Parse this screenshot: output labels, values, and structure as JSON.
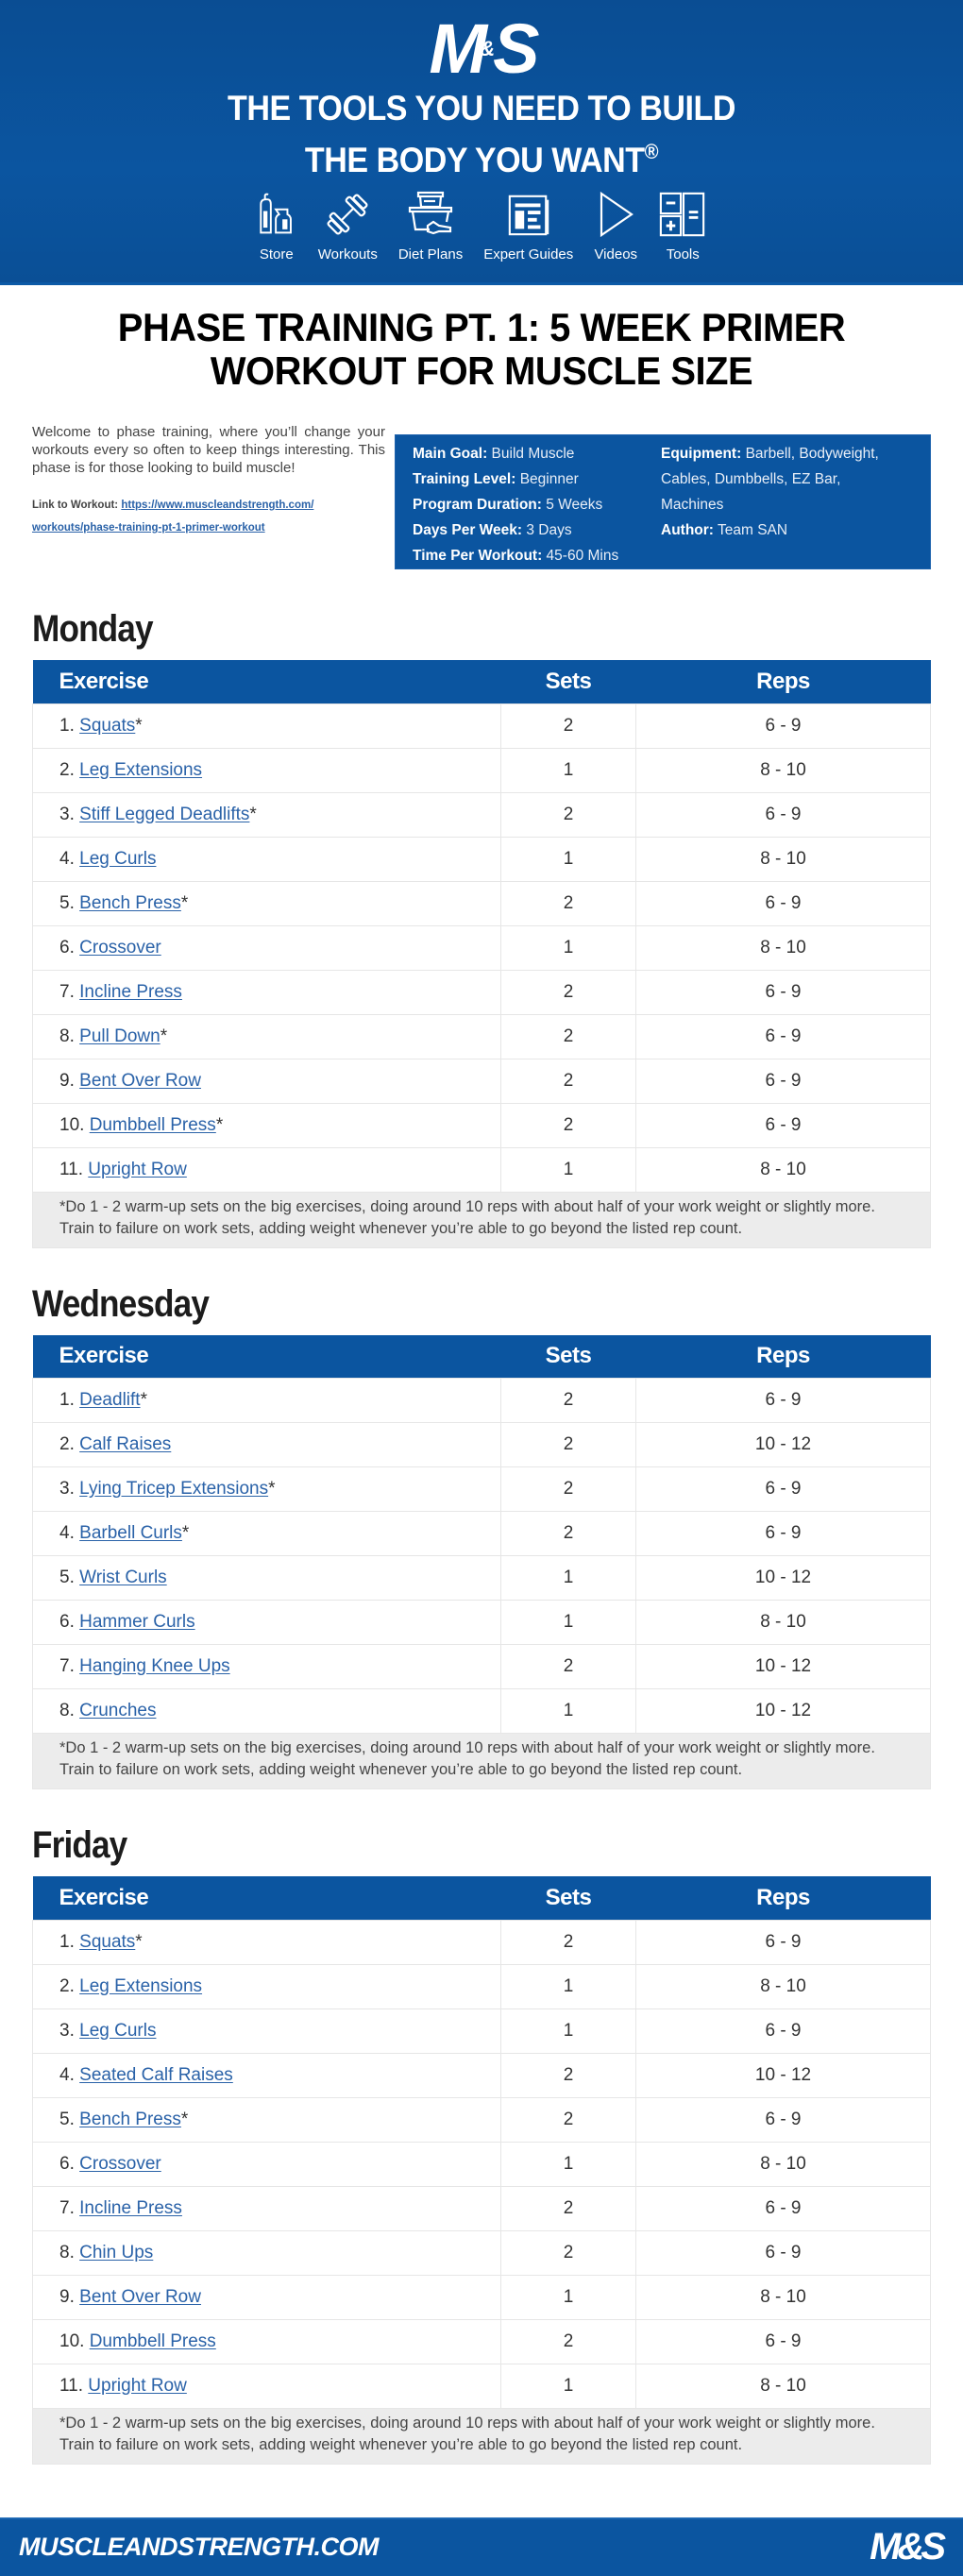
{
  "header": {
    "logo_text": "M&S",
    "tagline_line1": "THE TOOLS YOU NEED TO BUILD",
    "tagline_line2": "THE BODY YOU WANT",
    "tagline_mark": "®",
    "nav": [
      {
        "label": "Store",
        "icon": "store-icon"
      },
      {
        "label": "Workouts",
        "icon": "dumbbell-icon"
      },
      {
        "label": "Diet Plans",
        "icon": "diet-plans-icon"
      },
      {
        "label": "Expert Guides",
        "icon": "expert-guides-icon"
      },
      {
        "label": "Videos",
        "icon": "play-icon"
      },
      {
        "label": "Tools",
        "icon": "calculator-icon"
      }
    ]
  },
  "title_line1": "PHASE TRAINING PT. 1: 5 WEEK PRIMER",
  "title_line2": "WORKOUT FOR MUSCLE SIZE",
  "intro": {
    "text": "Welcome to phase training, where you’ll change your workouts every so often to keep things interesting. This phase is for those looking to build muscle!",
    "link_label": "Link to Workout:",
    "link_url_line1": "https://www.muscleandstrength.com/",
    "link_url_line2": "workouts/phase-training-pt-1-primer-workout"
  },
  "info": {
    "main_goal": {
      "label": "Main Goal:",
      "value": "Build Muscle"
    },
    "training_level": {
      "label": "Training Level:",
      "value": "Beginner"
    },
    "program_duration": {
      "label": "Program Duration:",
      "value": "5 Weeks"
    },
    "days_per_week": {
      "label": "Days Per Week:",
      "value": "3 Days"
    },
    "time_per_workout": {
      "label": "Time Per Workout:",
      "value": "45-60 Mins"
    },
    "equipment": {
      "label": "Equipment:",
      "value_line1": "Barbell, Bodyweight,",
      "value_line2": "Cables, Dumbbells, EZ Bar,",
      "value_line3": "Machines"
    },
    "author": {
      "label": "Author:",
      "value": "Team SAN"
    }
  },
  "table_headers": {
    "exercise": "Exercise",
    "sets": "Sets",
    "reps": "Reps"
  },
  "days": [
    {
      "name": "Monday",
      "rows": [
        {
          "num": "1.",
          "name": "Squats",
          "star": "*",
          "sets": "2",
          "reps": "6 - 9"
        },
        {
          "num": "2.",
          "name": "Leg Extensions",
          "star": "",
          "sets": "1",
          "reps": "8 - 10"
        },
        {
          "num": "3.",
          "name": "Stiff Legged Deadlifts",
          "star": "*",
          "sets": "2",
          "reps": "6 - 9"
        },
        {
          "num": "4.",
          "name": "Leg Curls",
          "star": "",
          "sets": "1",
          "reps": "8 - 10"
        },
        {
          "num": "5.",
          "name": "Bench Press",
          "star": "*",
          "sets": "2",
          "reps": "6 - 9"
        },
        {
          "num": "6.",
          "name": "Crossover",
          "star": "",
          "sets": "1",
          "reps": "8 - 10"
        },
        {
          "num": "7.",
          "name": "Incline Press",
          "star": "",
          "sets": "2",
          "reps": "6 - 9"
        },
        {
          "num": "8.",
          "name": "Pull Down",
          "star": "*",
          "sets": "2",
          "reps": "6 - 9"
        },
        {
          "num": "9.",
          "name": "Bent Over Row",
          "star": "",
          "sets": "2",
          "reps": "6 - 9"
        },
        {
          "num": "10.",
          "name": "Dumbbell Press",
          "star": "*",
          "sets": "2",
          "reps": "6 - 9"
        },
        {
          "num": "11.",
          "name": "Upright Row",
          "star": "",
          "sets": "1",
          "reps": "8 - 10"
        }
      ],
      "note": "*Do 1 - 2 warm-up sets on the big exercises, doing around 10 reps with about half of your work weight or slightly more. Train to failure on work sets, adding weight whenever you’re able to go beyond the listed rep count."
    },
    {
      "name": "Wednesday",
      "rows": [
        {
          "num": "1.",
          "name": "Deadlift",
          "star": "*",
          "sets": "2",
          "reps": "6 - 9"
        },
        {
          "num": "2.",
          "name": "Calf Raises",
          "star": "",
          "sets": "2",
          "reps": "10 - 12"
        },
        {
          "num": "3.",
          "name": "Lying Tricep Extensions",
          "star": "*",
          "sets": "2",
          "reps": "6 - 9"
        },
        {
          "num": "4.",
          "name": "Barbell Curls",
          "star": "*",
          "sets": "2",
          "reps": "6 - 9"
        },
        {
          "num": "5.",
          "name": "Wrist Curls",
          "star": "",
          "sets": "1",
          "reps": "10 - 12"
        },
        {
          "num": "6.",
          "name": "Hammer Curls",
          "star": "",
          "sets": "1",
          "reps": "8 - 10"
        },
        {
          "num": "7.",
          "name": "Hanging Knee Ups",
          "star": "",
          "sets": "2",
          "reps": "10 - 12"
        },
        {
          "num": "8.",
          "name": "Crunches",
          "star": "",
          "sets": "1",
          "reps": "10 - 12"
        }
      ],
      "note": "*Do 1 - 2 warm-up sets on the big exercises, doing around 10 reps with about half of your work weight or slightly more. Train to failure on work sets, adding weight whenever you’re able to go beyond the listed rep count."
    },
    {
      "name": "Friday",
      "rows": [
        {
          "num": "1.",
          "name": "Squats",
          "star": "*",
          "sets": "2",
          "reps": "6 - 9"
        },
        {
          "num": "2.",
          "name": "Leg Extensions",
          "star": "",
          "sets": "1",
          "reps": "8 - 10"
        },
        {
          "num": "3.",
          "name": "Leg Curls",
          "star": "",
          "sets": "1",
          "reps": "6 - 9"
        },
        {
          "num": "4.",
          "name": "Seated Calf Raises",
          "star": "",
          "sets": "2",
          "reps": "10 - 12"
        },
        {
          "num": "5.",
          "name": "Bench Press",
          "star": "*",
          "sets": "2",
          "reps": "6 - 9"
        },
        {
          "num": "6.",
          "name": "Crossover",
          "star": "",
          "sets": "1",
          "reps": "8 - 10"
        },
        {
          "num": "7.",
          "name": "Incline Press",
          "star": "",
          "sets": "2",
          "reps": "6 - 9"
        },
        {
          "num": "8.",
          "name": "Chin Ups",
          "star": "",
          "sets": "2",
          "reps": "6 - 9"
        },
        {
          "num": "9.",
          "name": "Bent Over Row",
          "star": "",
          "sets": "1",
          "reps": "8 - 10"
        },
        {
          "num": "10.",
          "name": "Dumbbell Press",
          "star": "",
          "sets": "2",
          "reps": "6 - 9"
        },
        {
          "num": "11.",
          "name": "Upright Row",
          "star": "",
          "sets": "1",
          "reps": "8 - 10"
        }
      ],
      "note": "*Do 1 - 2 warm-up sets on the big exercises, doing around 10 reps with about half of your work weight or slightly more. Train to failure on work sets, adding weight whenever you’re able to go beyond the listed rep count."
    }
  ],
  "footer": {
    "url": "MUSCLEANDSTRENGTH.COM",
    "logo_text": "M&S"
  },
  "colors": {
    "brand_blue": "#0b55a0",
    "link_blue": "#2a62a8",
    "note_bg": "#ececec"
  }
}
